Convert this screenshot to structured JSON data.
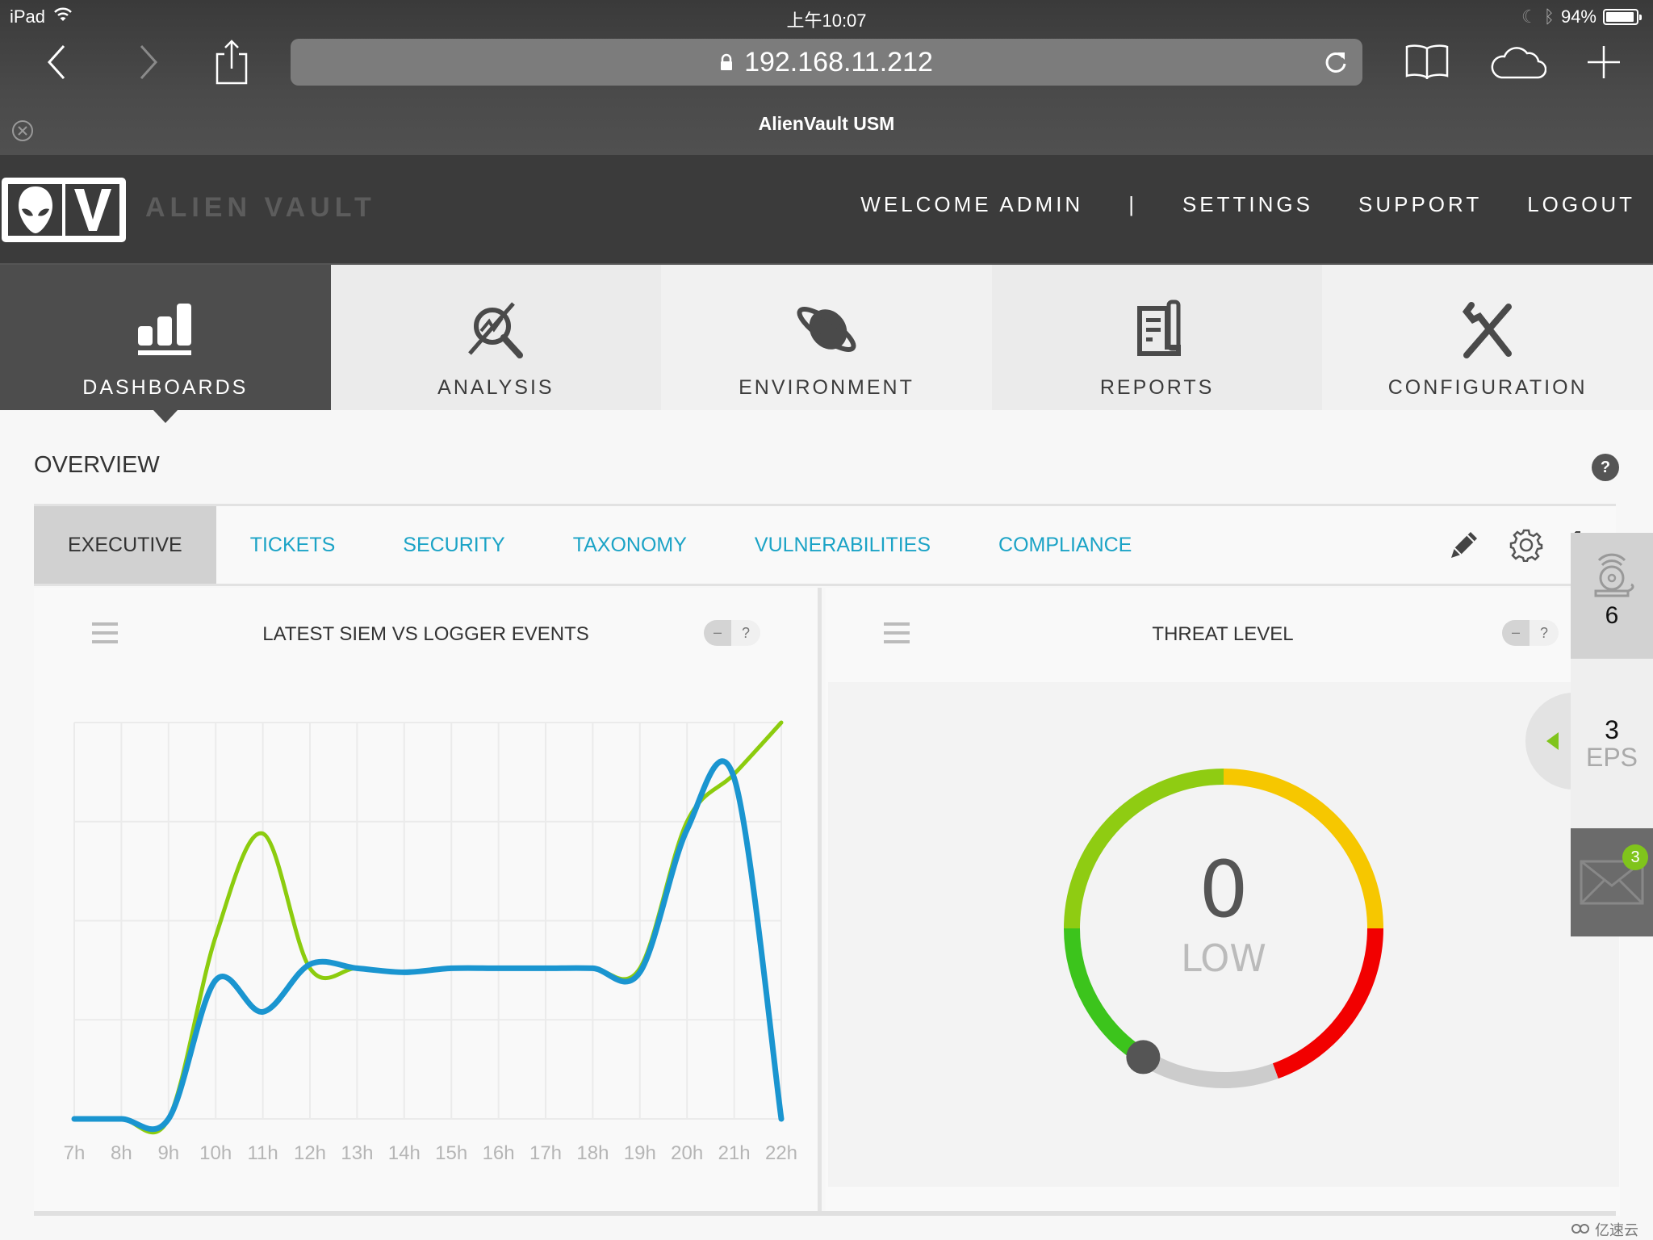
{
  "ios": {
    "device": "iPad",
    "time": "上午10:07",
    "battery_percent": "94%",
    "battery_level": 0.94,
    "url": "192.168.11.212",
    "page_title": "AlienVault USM"
  },
  "header": {
    "logo_text": "ALIEN VAULT",
    "welcome": "WELCOME ADMIN",
    "separator": "|",
    "links": [
      "SETTINGS",
      "SUPPORT",
      "LOGOUT"
    ]
  },
  "mainnav": [
    {
      "label": "DASHBOARDS",
      "icon": "bar-chart-icon",
      "active": true
    },
    {
      "label": "ANALYSIS",
      "icon": "analysis-magnifier-icon",
      "active": false
    },
    {
      "label": "ENVIRONMENT",
      "icon": "planet-icon",
      "active": false
    },
    {
      "label": "REPORTS",
      "icon": "report-document-icon",
      "active": false
    },
    {
      "label": "CONFIGURATION",
      "icon": "tools-icon",
      "active": false
    }
  ],
  "overview": {
    "title": "OVERVIEW",
    "help": "?",
    "tabs": [
      {
        "label": "EXECUTIVE",
        "active": true
      },
      {
        "label": "TICKETS",
        "active": false
      },
      {
        "label": "SECURITY",
        "active": false
      },
      {
        "label": "TAXONOMY",
        "active": false
      },
      {
        "label": "VULNERABILITIES",
        "active": false
      },
      {
        "label": "COMPLIANCE",
        "active": false
      }
    ],
    "tools": [
      "pencil-icon",
      "gear-icon",
      "fullscreen-icon"
    ]
  },
  "widgets": {
    "left": {
      "title": "LATEST SIEM VS LOGGER EVENTS",
      "toggle_min": "–",
      "toggle_help": "?"
    },
    "right": {
      "title": "THREAT LEVEL",
      "toggle_min": "–",
      "toggle_help": "?"
    }
  },
  "threat": {
    "value": "0",
    "label": "LOW",
    "level_fraction": 0.0,
    "colors": {
      "green": "#3cc41c",
      "light_green": "#8fcc12",
      "yellow": "#f6c700",
      "red": "#f20000",
      "inactive": "#cccccc",
      "knob": "#555555"
    }
  },
  "side_panel": {
    "alarms_count": "6",
    "eps_value": "3",
    "eps_label": "EPS",
    "messages_badge": "3"
  },
  "watermark": "亿速云",
  "colors": {
    "accent_link": "#1ba3c6",
    "siem_line": "#8ccc0e",
    "logger_line": "#1a95d0",
    "header_bg": "#3b3b3b"
  },
  "chart_data": {
    "type": "line",
    "title": "LATEST SIEM VS LOGGER EVENTS",
    "xlabel": "",
    "ylabel": "",
    "x": [
      "7h",
      "8h",
      "9h",
      "10h",
      "11h",
      "12h",
      "13h",
      "14h",
      "15h",
      "16h",
      "17h",
      "18h",
      "19h",
      "20h",
      "21h",
      "22h"
    ],
    "ylim": [
      0,
      100
    ],
    "y_units": "relative (no y-axis labels shown)",
    "grid": true,
    "legend": "none",
    "series": [
      {
        "name": "SIEM",
        "color": "#8ccc0e",
        "values": [
          0,
          0,
          0,
          46,
          72,
          38,
          38,
          37,
          38,
          38,
          38,
          38,
          38,
          75,
          87,
          100
        ]
      },
      {
        "name": "Logger",
        "color": "#1a95d0",
        "values": [
          0,
          0,
          0,
          35,
          27,
          39,
          38,
          37,
          38,
          38,
          38,
          38,
          37,
          73,
          86,
          0
        ]
      }
    ]
  }
}
